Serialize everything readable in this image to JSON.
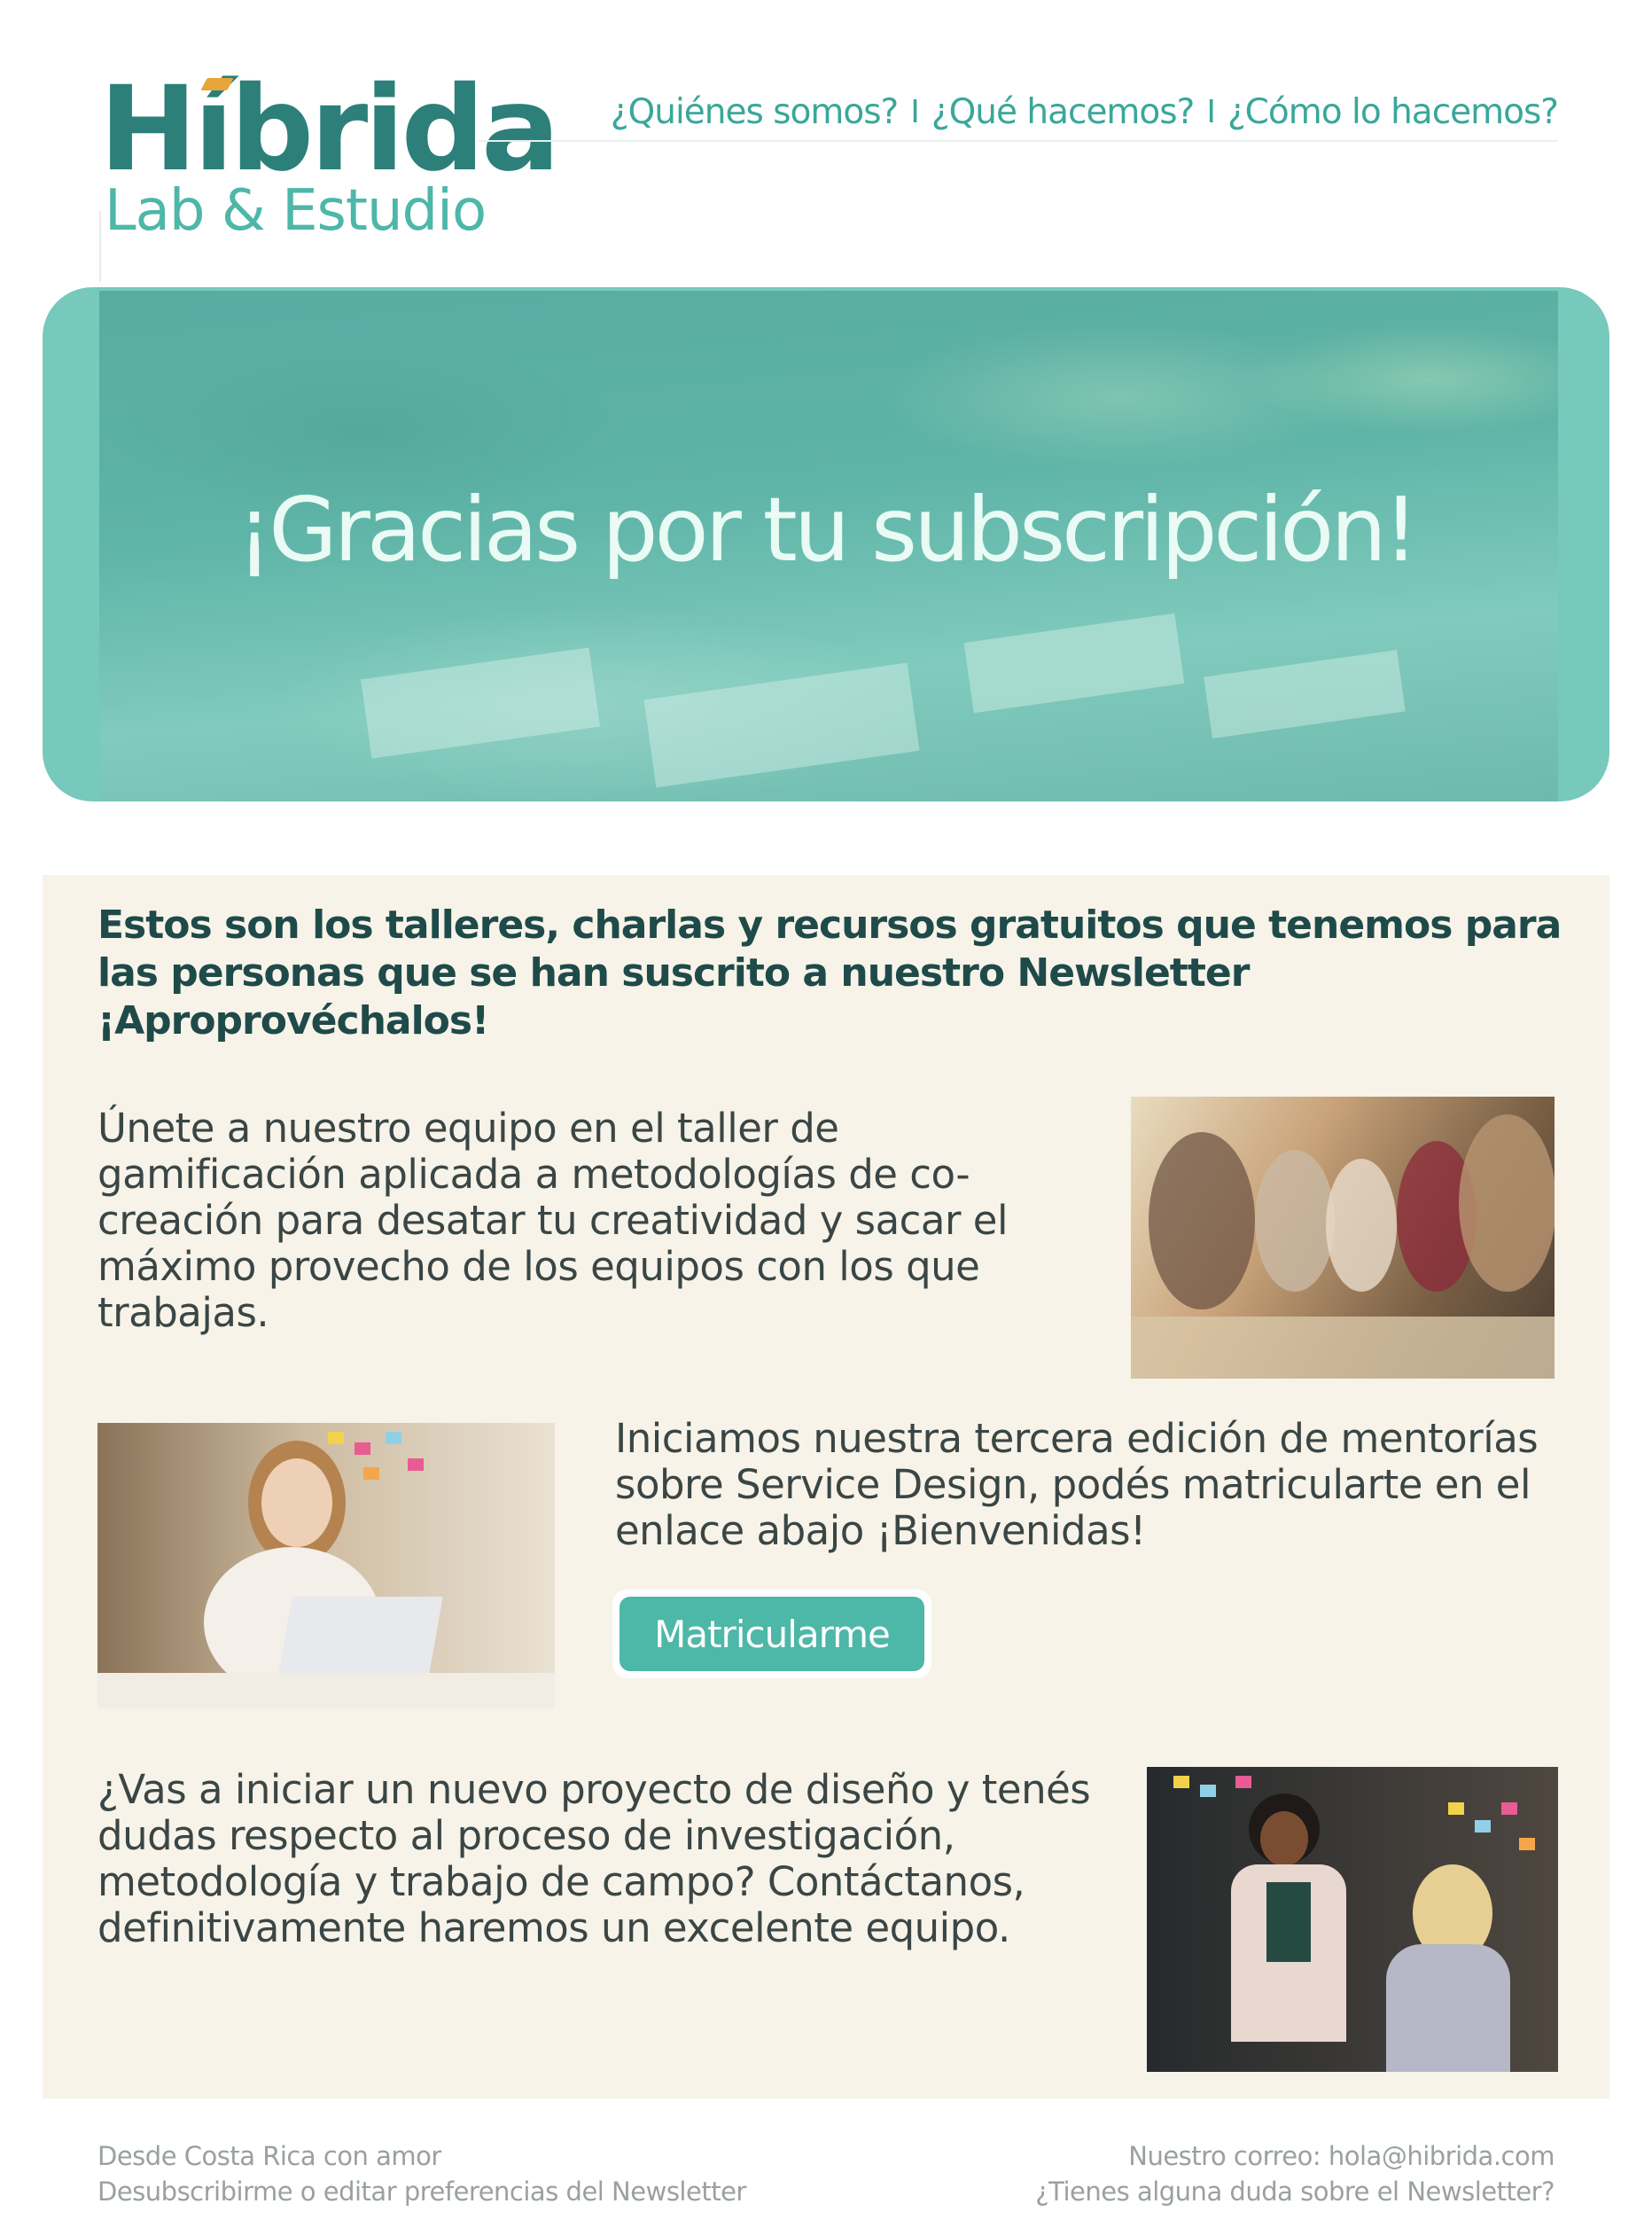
{
  "brand": {
    "logo_main": "Híbrida",
    "logo_sub": "Lab & Estudio",
    "colors": {
      "primary": "#2c8079",
      "accent": "#4db7a8",
      "hero": "#76c9bb",
      "panel": "#f7f3e8",
      "highlight": "#e6a63a"
    }
  },
  "nav": {
    "items": [
      {
        "label": "¿Quiénes somos?"
      },
      {
        "label": "¿Qué hacemos?"
      },
      {
        "label": "¿Cómo lo hacemos?"
      }
    ],
    "separator": "I"
  },
  "hero": {
    "title": "¡Gracias por tu subscripción!"
  },
  "content": {
    "intro": "Estos son los talleres, charlas y recursos gratuitos que tenemos para las personas que se han suscrito a nuestro Newsletter ¡Aproprovéchalos!",
    "blocks": [
      {
        "text": "Únete a nuestro equipo en el taller de gamificación aplicada a metodologías de co-creación para desatar tu creatividad y sacar el máximo provecho de los equipos con los que trabajas."
      },
      {
        "text": "Iniciamos nuestra tercera edición de mentorías sobre Service Design, podés matricularte en el enlace abajo ¡Bienvenidas!",
        "button_label": "Matricularme"
      },
      {
        "text": "¿Vas a iniciar un nuevo proyecto de diseño y tenés dudas respecto al proceso de investigación, metodología y trabajo de campo? Contáctanos, definitivamente haremos un excelente equipo."
      }
    ]
  },
  "footer": {
    "left_line1": "Desde Costa Rica con amor",
    "left_line2": "Desubscribirme o editar preferencias del Newsletter",
    "email_label": "Nuestro correo:",
    "email": "hola@hibrida.com",
    "question": "¿Tienes alguna duda sobre el Newsletter?"
  }
}
